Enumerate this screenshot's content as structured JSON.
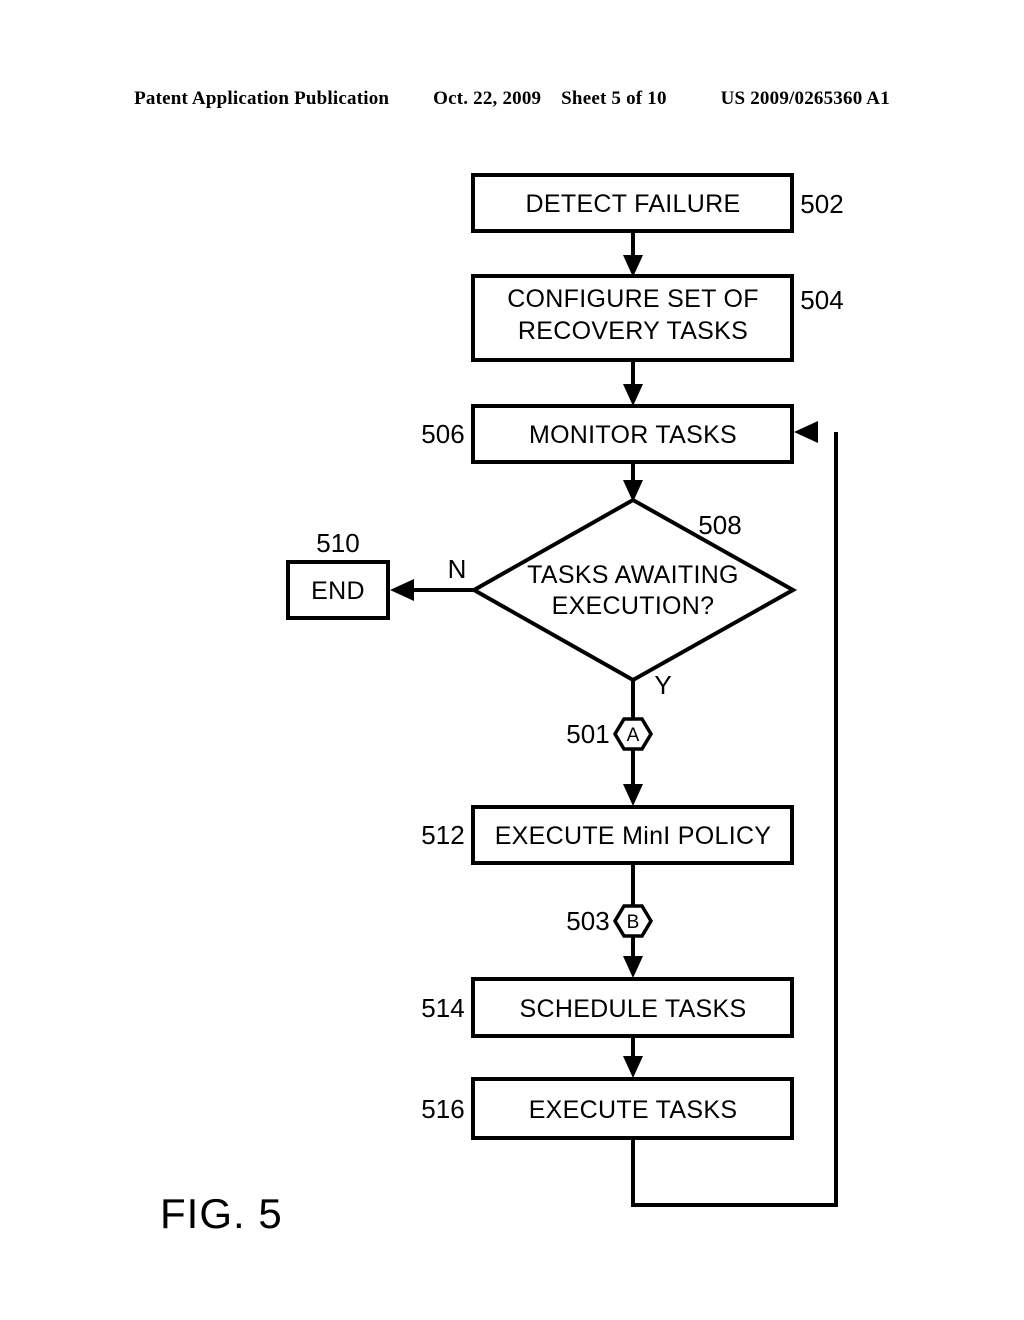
{
  "page_header": {
    "publication": "Patent Application Publication",
    "date": "Oct. 22, 2009",
    "sheet": "Sheet 5 of 10",
    "patent_number": "US 2009/0265360 A1"
  },
  "figure": {
    "caption": "FIG. 5"
  },
  "flowchart": {
    "nodes": [
      {
        "id": "detect-failure",
        "shape": "process",
        "label": "DETECT FAILURE",
        "ref": "502",
        "ref_side": "right"
      },
      {
        "id": "configure-recovery-tasks",
        "shape": "process",
        "label_line1": "CONFIGURE SET OF",
        "label_line2": "RECOVERY TASKS",
        "ref": "504",
        "ref_side": "right"
      },
      {
        "id": "monitor-tasks",
        "shape": "process",
        "label": "MONITOR TASKS",
        "ref": "506",
        "ref_side": "left"
      },
      {
        "id": "tasks-awaiting-execution",
        "shape": "decision",
        "label_line1": "TASKS AWAITING",
        "label_line2": "EXECUTION?",
        "ref": "508",
        "ref_side": "right"
      },
      {
        "id": "end",
        "shape": "terminator",
        "label": "END",
        "ref": "510",
        "ref_side": "top"
      },
      {
        "id": "connector-a",
        "shape": "connector",
        "label": "A",
        "ref": "501",
        "ref_side": "left"
      },
      {
        "id": "execute-mini-policy",
        "shape": "process",
        "label": "EXECUTE MinI POLICY",
        "ref": "512",
        "ref_side": "left"
      },
      {
        "id": "connector-b",
        "shape": "connector",
        "label": "B",
        "ref": "503",
        "ref_side": "left"
      },
      {
        "id": "schedule-tasks",
        "shape": "process",
        "label": "SCHEDULE TASKS",
        "ref": "514",
        "ref_side": "left"
      },
      {
        "id": "execute-tasks",
        "shape": "process",
        "label": "EXECUTE TASKS",
        "ref": "516",
        "ref_side": "left"
      }
    ],
    "branch_labels": {
      "no": "N",
      "yes": "Y"
    }
  }
}
